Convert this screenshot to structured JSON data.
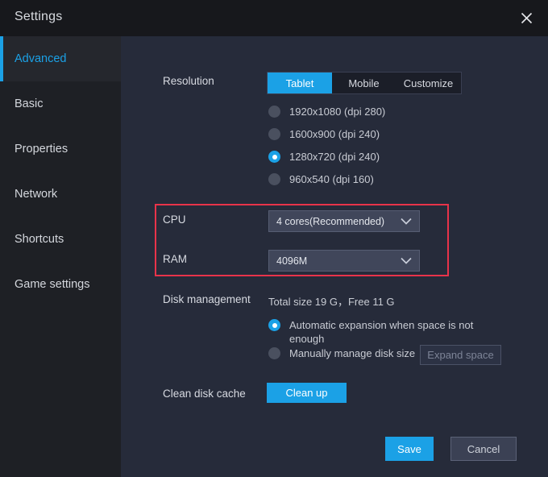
{
  "window": {
    "title": "Settings",
    "close_icon": "close-icon"
  },
  "sidebar": {
    "items": [
      {
        "label": "Advanced",
        "active": true
      },
      {
        "label": "Basic",
        "active": false
      },
      {
        "label": "Properties",
        "active": false
      },
      {
        "label": "Network",
        "active": false
      },
      {
        "label": "Shortcuts",
        "active": false
      },
      {
        "label": "Game settings",
        "active": false
      }
    ]
  },
  "main": {
    "resolution": {
      "label": "Resolution",
      "tabs": [
        {
          "label": "Tablet",
          "active": true
        },
        {
          "label": "Mobile",
          "active": false
        },
        {
          "label": "Customize",
          "active": false
        }
      ],
      "options": [
        {
          "label": "1920x1080  (dpi 280)",
          "selected": false
        },
        {
          "label": "1600x900  (dpi 240)",
          "selected": false
        },
        {
          "label": "1280x720  (dpi 240)",
          "selected": true
        },
        {
          "label": "960x540  (dpi 160)",
          "selected": false
        }
      ]
    },
    "cpu": {
      "label": "CPU",
      "value": "4 cores(Recommended)",
      "arrow_icon": "chevron-down-icon"
    },
    "ram": {
      "label": "RAM",
      "value": "4096M",
      "arrow_icon": "chevron-down-icon"
    },
    "disk": {
      "label": "Disk management",
      "summary": "Total size 19 G，Free 11 G",
      "options": [
        {
          "label": "Automatic expansion when space is not enough",
          "selected": true
        },
        {
          "label": "Manually manage disk size",
          "selected": false
        }
      ],
      "expand_button": "Expand space"
    },
    "cache": {
      "label": "Clean disk cache",
      "button": "Clean up"
    }
  },
  "footer": {
    "save": "Save",
    "cancel": "Cancel"
  },
  "colors": {
    "accent": "#1ba1e6",
    "annotation": "#e8334a",
    "titlebar_bg": "#17181c",
    "sidebar_bg": "#1e2025",
    "content_bg": "#262b3a"
  }
}
